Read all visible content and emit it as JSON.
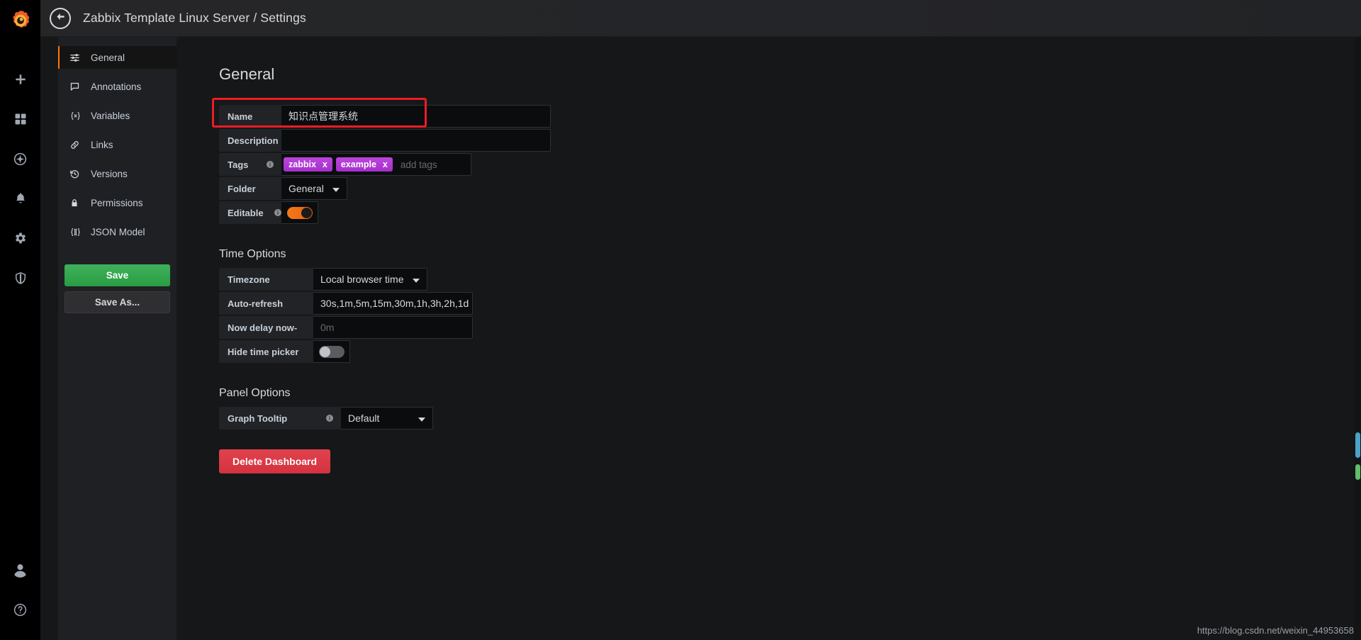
{
  "app": {
    "logo_icon": "grafana-logo-icon",
    "watermark": "https://blog.csdn.net/weixin_44953658"
  },
  "rail": {
    "items": [
      {
        "icon": "plus-icon",
        "name": "create"
      },
      {
        "icon": "dashboards-grid-icon",
        "name": "dashboards"
      },
      {
        "icon": "compass-explore-icon",
        "name": "explore"
      },
      {
        "icon": "bell-alerting-icon",
        "name": "alerting"
      },
      {
        "icon": "gear-configuration-icon",
        "name": "configuration"
      },
      {
        "icon": "shield-server-admin-icon",
        "name": "server-admin"
      }
    ],
    "bottom": [
      {
        "icon": "user-avatar-icon",
        "name": "profile"
      },
      {
        "icon": "help-question-icon",
        "name": "help"
      }
    ]
  },
  "topbar": {
    "back_icon": "arrow-left-icon",
    "title": "Zabbix Template Linux Server / Settings"
  },
  "settings_nav": {
    "items": [
      {
        "label": "General",
        "icon": "sliders-icon",
        "active": true
      },
      {
        "label": "Annotations",
        "icon": "comment-icon",
        "active": false
      },
      {
        "label": "Variables",
        "icon": "braces-x-icon",
        "active": false
      },
      {
        "label": "Links",
        "icon": "link-icon",
        "active": false
      },
      {
        "label": "Versions",
        "icon": "history-icon",
        "active": false
      },
      {
        "label": "Permissions",
        "icon": "lock-icon",
        "active": false
      },
      {
        "label": "JSON Model",
        "icon": "brackets-icon",
        "active": false
      }
    ],
    "save_label": "Save",
    "save_as_label": "Save As..."
  },
  "general": {
    "heading": "General",
    "name": {
      "label": "Name",
      "value": "知识点管理系统",
      "highlighted": true
    },
    "description": {
      "label": "Description",
      "value": "",
      "placeholder": ""
    },
    "tags": {
      "label": "Tags",
      "info_icon": "info-circle-icon",
      "values": [
        "zabbix",
        "example"
      ],
      "remove_label": "x",
      "placeholder": "add tags"
    },
    "folder": {
      "label": "Folder",
      "value": "General",
      "caret_icon": "chevron-down-icon"
    },
    "editable": {
      "label": "Editable",
      "info_icon": "info-circle-icon",
      "state": "on"
    }
  },
  "time_options": {
    "heading": "Time Options",
    "timezone": {
      "label": "Timezone",
      "value": "Local browser time",
      "caret_icon": "chevron-down-icon"
    },
    "auto_refresh": {
      "label": "Auto-refresh",
      "value": "30s,1m,5m,15m,30m,1h,3h,2h,1d"
    },
    "now_delay": {
      "label": "Now delay now-",
      "value": "",
      "placeholder": "0m"
    },
    "hide_time_picker": {
      "label": "Hide time picker",
      "state": "off"
    }
  },
  "panel_options": {
    "heading": "Panel Options",
    "graph_tooltip": {
      "label": "Graph Tooltip",
      "info_icon": "info-circle-icon",
      "value": "Default",
      "caret_icon": "chevron-down-icon"
    }
  },
  "actions": {
    "delete_label": "Delete Dashboard"
  },
  "colors": {
    "accent_orange": "#ff780a",
    "save_green": "#299c43",
    "delete_red": "#d4323f",
    "tag_purple": "#b33ad5",
    "highlight_red": "#ec1c24",
    "bg": "#161719",
    "panel_bg": "#1f2024"
  }
}
